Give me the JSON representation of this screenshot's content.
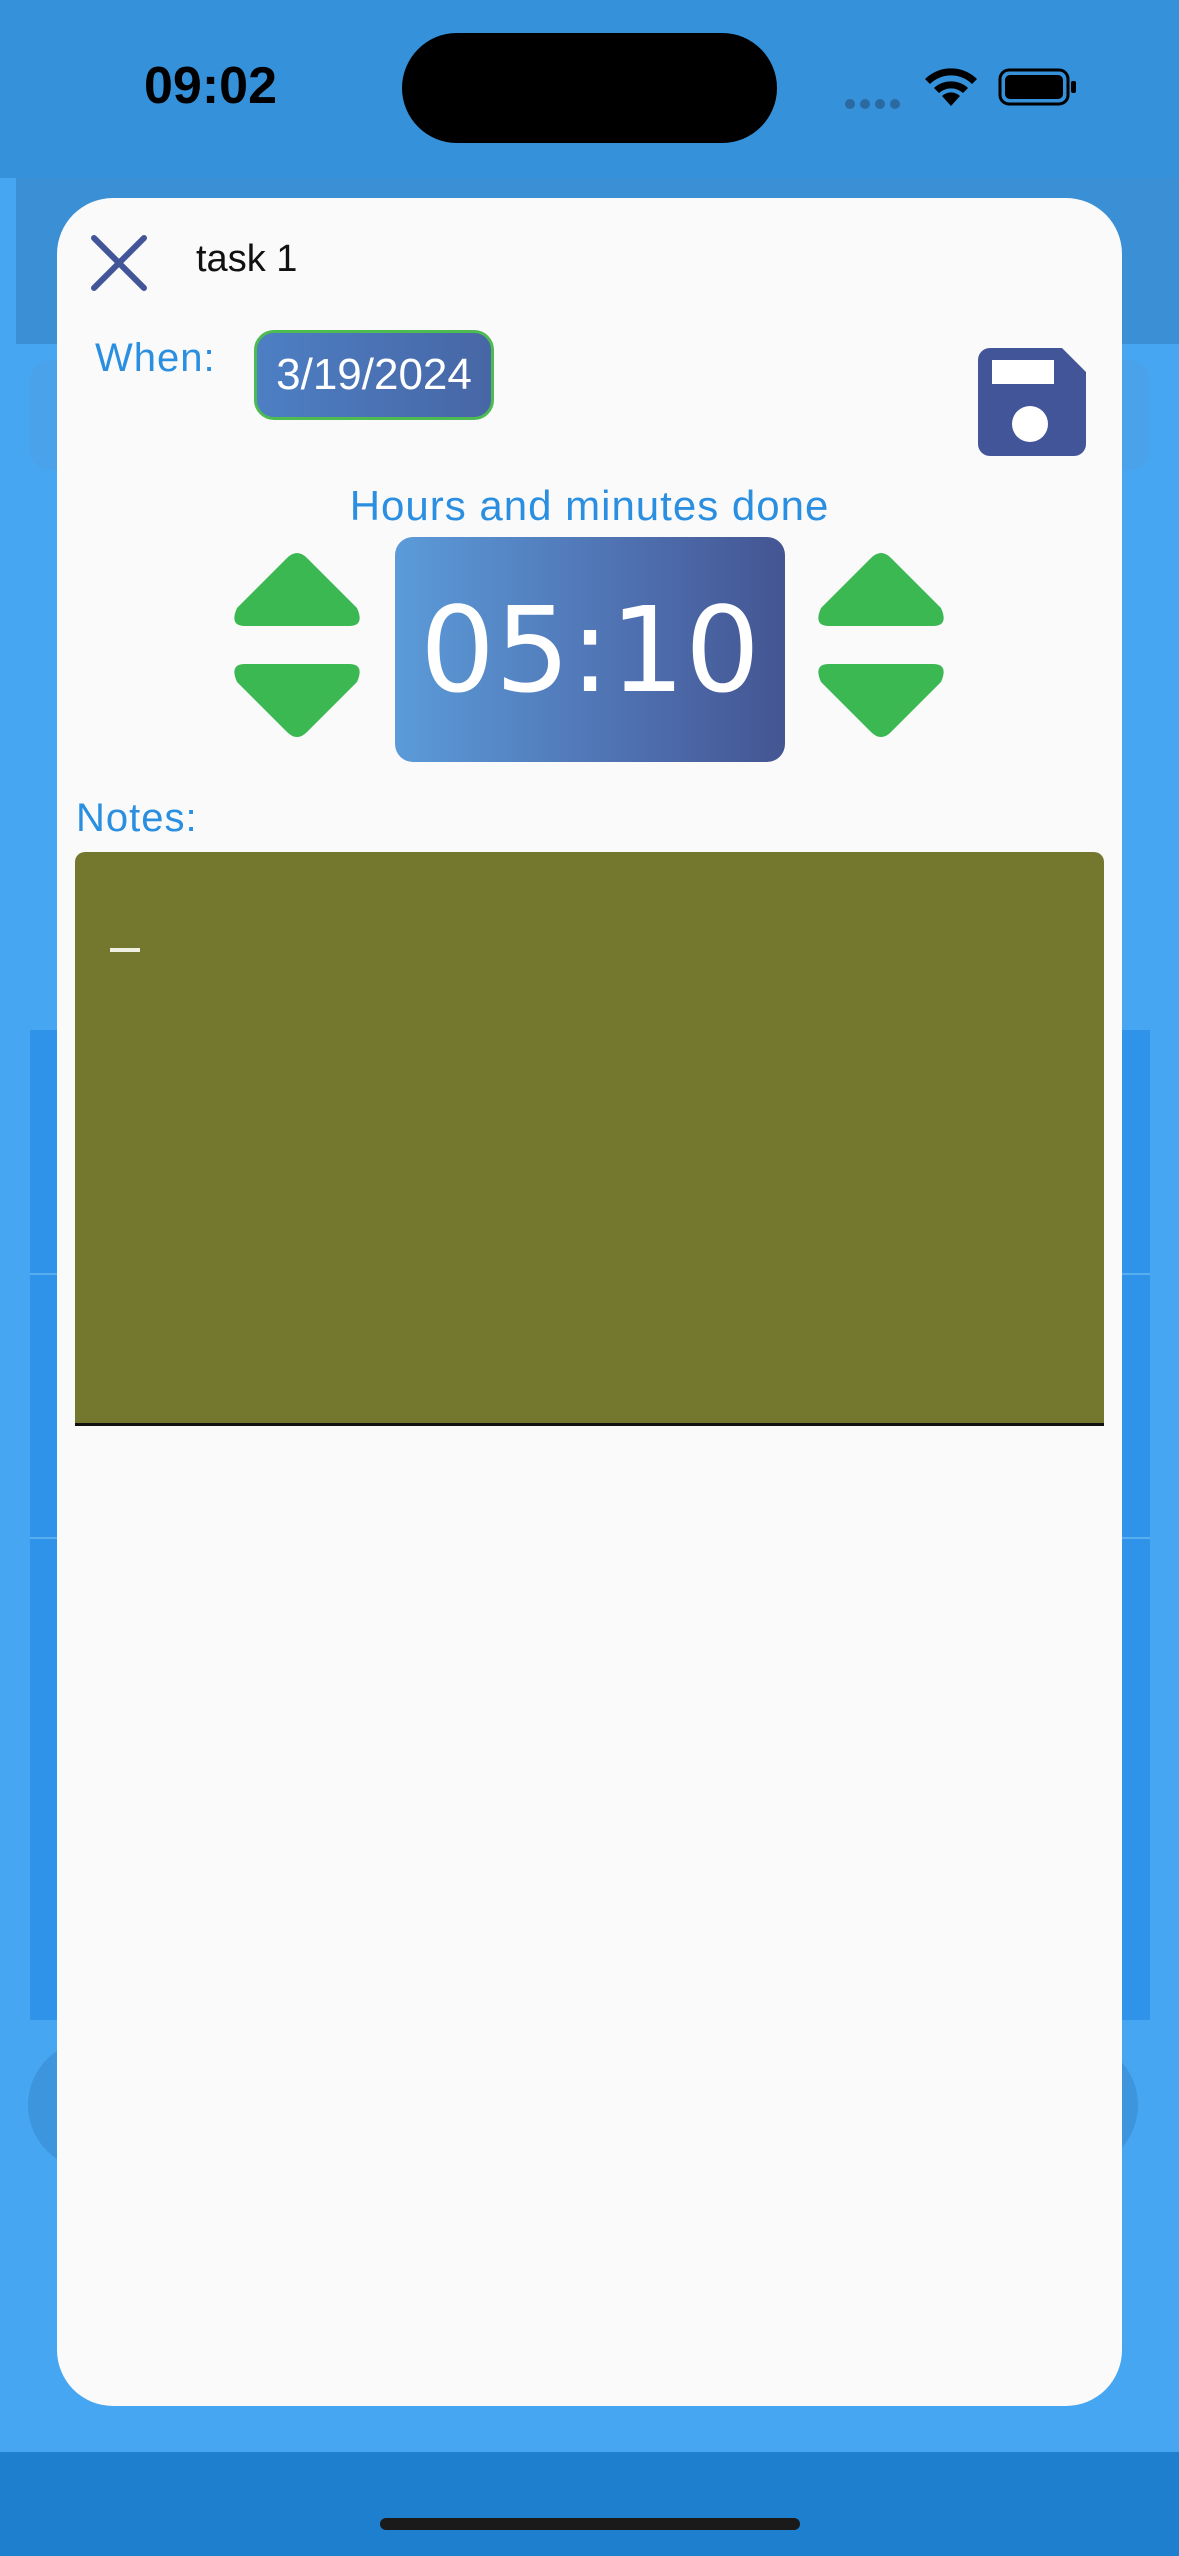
{
  "status_bar": {
    "time": "09:02"
  },
  "dialog": {
    "title": "task 1",
    "when_label": "When:",
    "date_value": "3/19/2024",
    "duration_label": "Hours and minutes done",
    "duration_value": "05:10",
    "notes_label": "Notes:",
    "notes_value": ""
  },
  "icons": {
    "close": "close-icon",
    "save": "floppy-disk-icon",
    "hours_up": "triangle-up-icon",
    "hours_down": "triangle-down-icon",
    "minutes_up": "triangle-up-icon",
    "minutes_down": "triangle-down-icon"
  },
  "colors": {
    "accent_text": "#2a8fe0",
    "arrow_green": "#3cb852",
    "icon_navy": "#425598",
    "notes_bg": "#73782e",
    "backdrop": "#46a6f2"
  }
}
